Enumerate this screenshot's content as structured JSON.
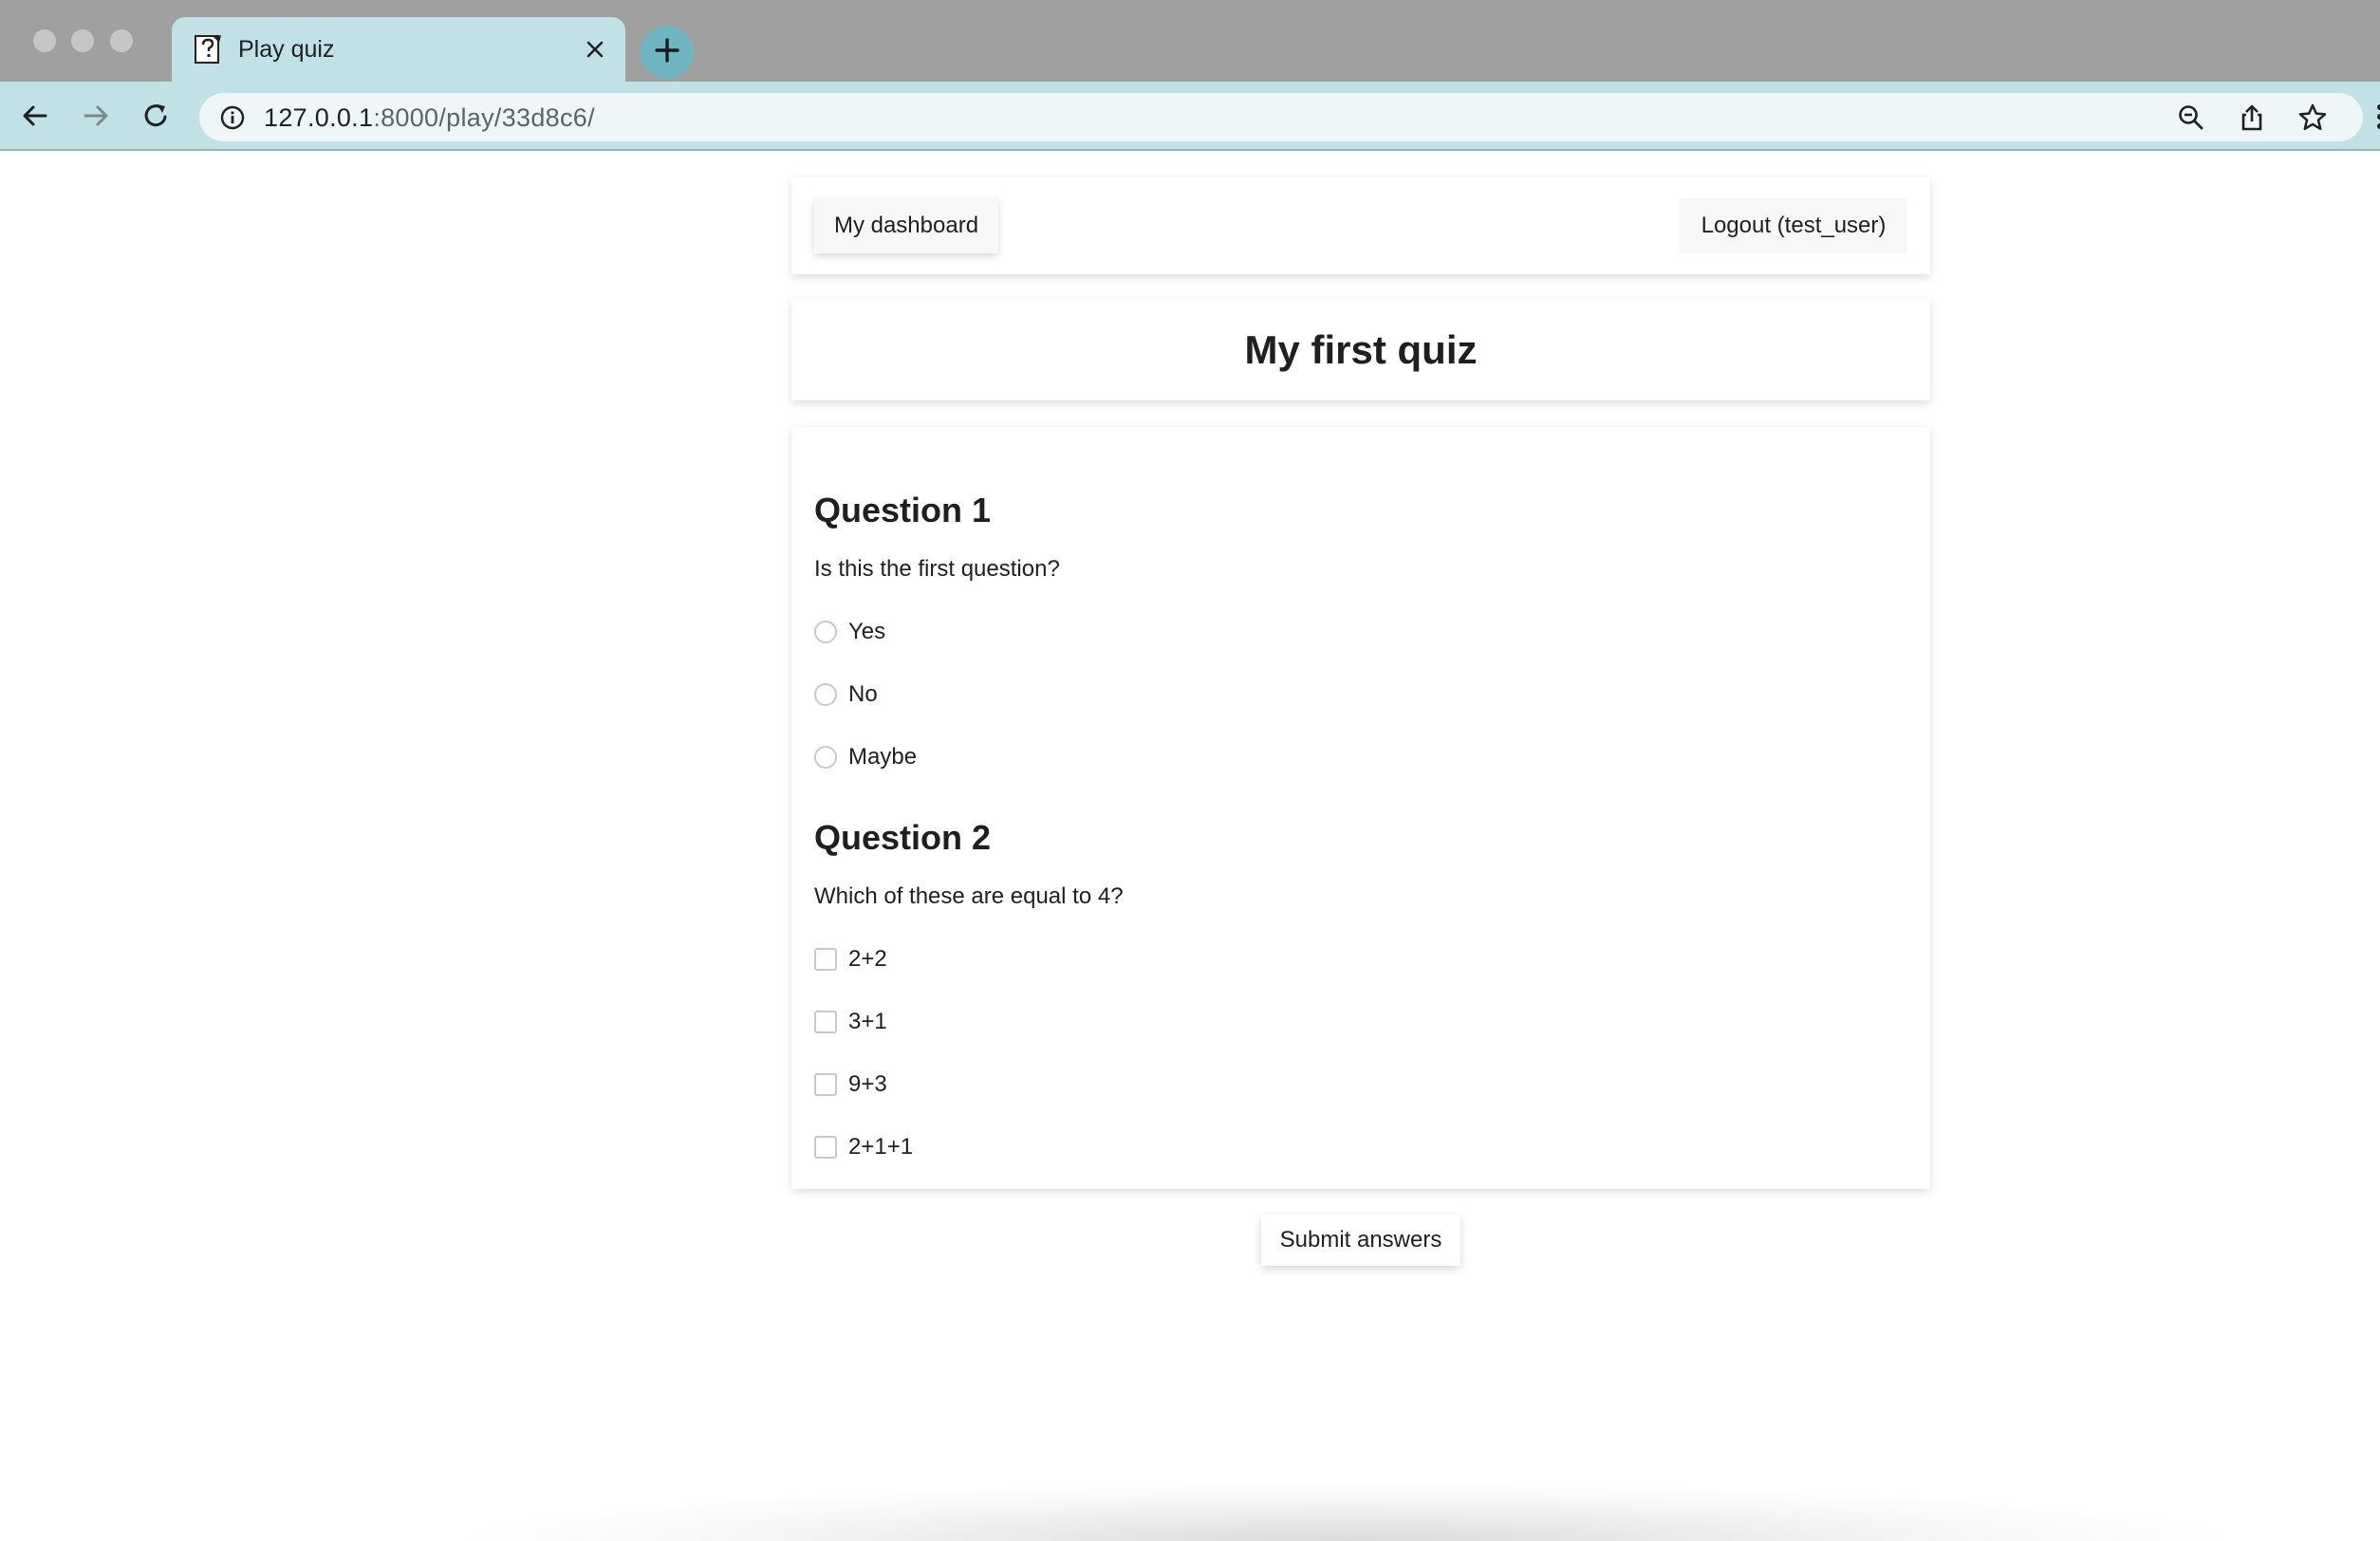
{
  "browser": {
    "tab": {
      "title": "Play quiz",
      "favicon": "quiz-page-icon"
    },
    "url": {
      "host": "127.0.0.1",
      "rest": ":8000/play/33d8c6/"
    },
    "icons": {
      "close_tab": "close-icon",
      "new_tab": "plus-icon",
      "back": "arrow-left-icon",
      "forward": "arrow-right-icon",
      "reload": "reload-icon",
      "site_info": "info-icon",
      "zoom": "zoom-out-icon",
      "share": "share-icon",
      "bookmark": "star-icon"
    },
    "colors": {
      "frame": "#a0a0a0",
      "toolbar": "#c1e1e6",
      "new_tab_button": "#6fb6c2"
    }
  },
  "nav": {
    "dashboard_label": "My dashboard",
    "logout_label": "Logout (test_user)"
  },
  "quiz": {
    "title": "My first quiz",
    "questions": [
      {
        "heading": "Question 1",
        "text": "Is this the first question?",
        "input_type": "radio",
        "options": [
          "Yes",
          "No",
          "Maybe"
        ]
      },
      {
        "heading": "Question 2",
        "text": "Which of these are equal to 4?",
        "input_type": "checkbox",
        "options": [
          "2+2",
          "3+1",
          "9+3",
          "2+1+1"
        ]
      }
    ],
    "submit_label": "Submit answers"
  }
}
